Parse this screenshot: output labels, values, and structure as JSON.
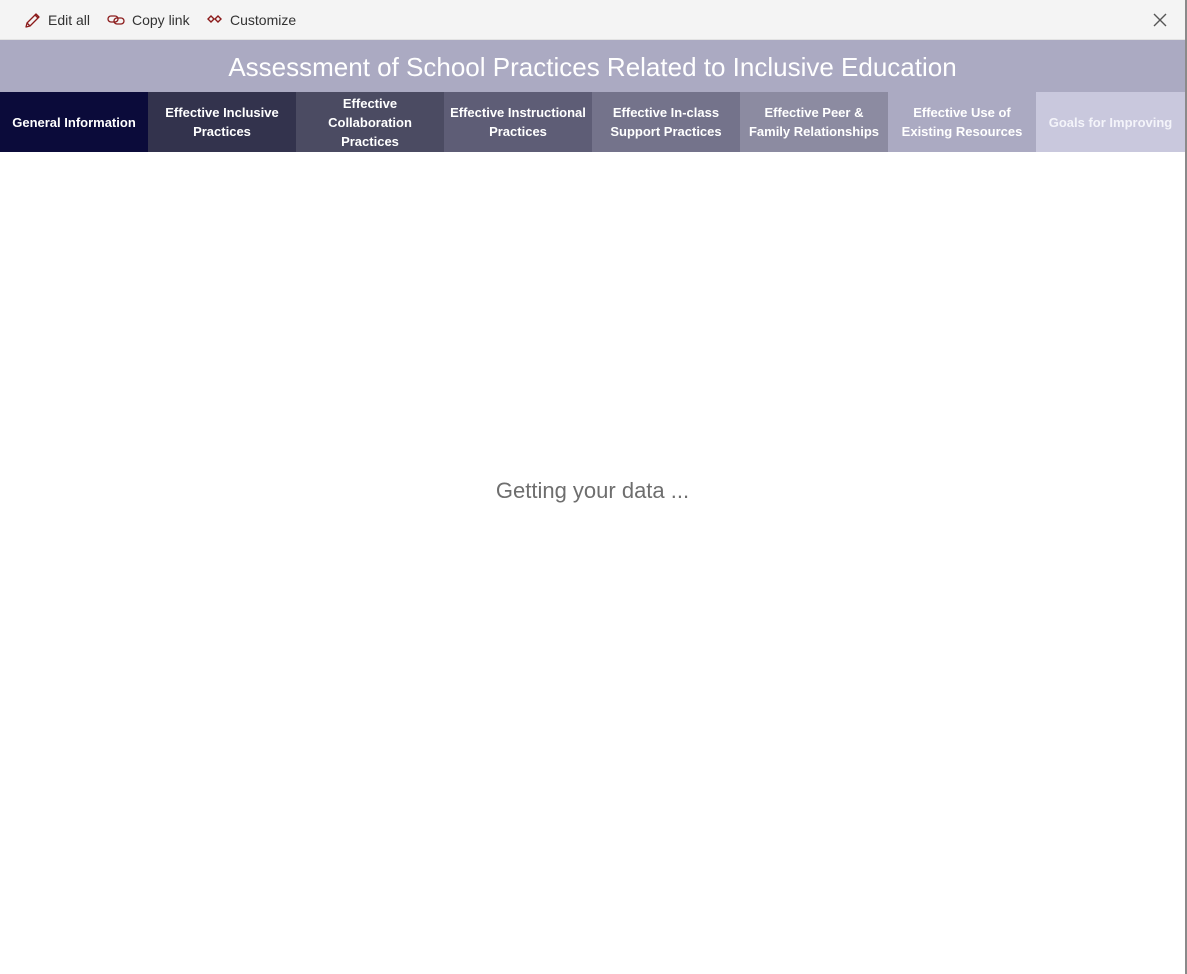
{
  "toolbar": {
    "edit_all": "Edit all",
    "copy_link": "Copy link",
    "customize": "Customize",
    "edit_icon": "pencil-icon",
    "copy_icon": "link-icon",
    "customize_icon": "diamonds-icon",
    "close_icon": "close-icon",
    "icon_color": "#8b1a1a"
  },
  "banner": {
    "title": "Assessment of School Practices Related to Inclusive Education",
    "background": "#abaac2"
  },
  "tabs": [
    {
      "label": "General Information",
      "bg": "#0b0b3a",
      "fg": "#ffffff"
    },
    {
      "label": "Effective Inclusive\nPractices",
      "bg": "#33334d",
      "fg": "#ffffff"
    },
    {
      "label": "Effective\nCollaboration\nPractices",
      "bg": "#4b4b62",
      "fg": "#ffffff"
    },
    {
      "label": "Effective Instructional\nPractices",
      "bg": "#5e5d76",
      "fg": "#ffffff"
    },
    {
      "label": "Effective In-class\nSupport Practices",
      "bg": "#74738b",
      "fg": "#ffffff"
    },
    {
      "label": "Effective Peer &\nFamily Relationships",
      "bg": "#8c8ba1",
      "fg": "#ffffff"
    },
    {
      "label": "Effective Use of\nExisting Resources",
      "bg": "#abaac2",
      "fg": "#ffffff"
    },
    {
      "label": "Goals for Improving",
      "bg": "#c9c8dd",
      "fg": "#f4f4fa"
    }
  ],
  "status": {
    "loading_text": "Getting your data ..."
  }
}
